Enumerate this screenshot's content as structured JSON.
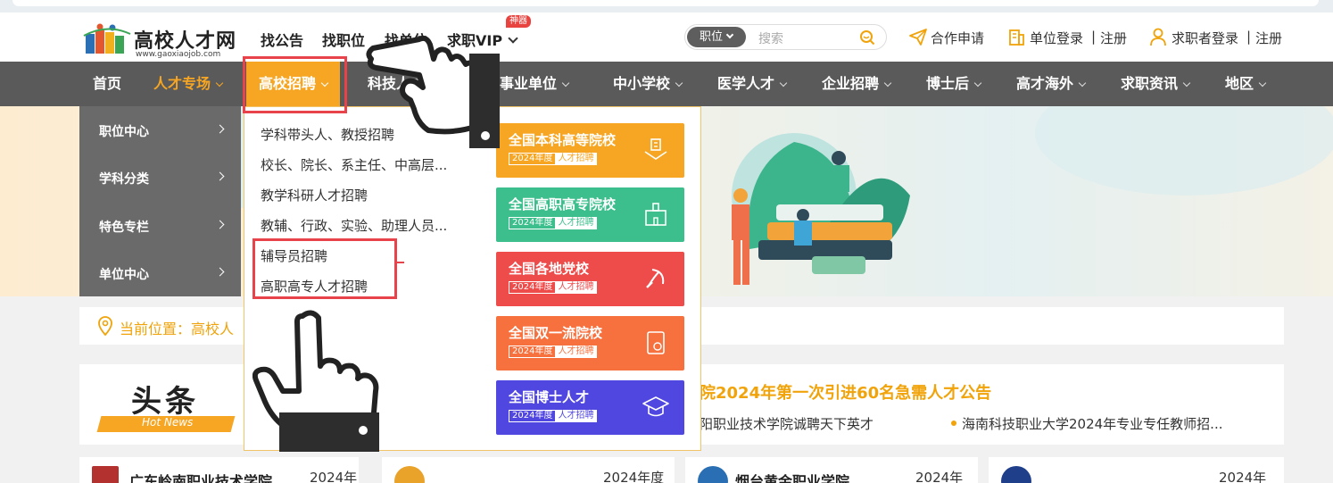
{
  "header": {
    "logo_title": "高校人才网",
    "logo_url": "www.gaoxiaojob.com",
    "top_links": [
      "找公告",
      "找职位",
      "找单位",
      "求职VIP"
    ],
    "vip_badge": "神器",
    "search": {
      "category": "职位",
      "placeholder": "搜索"
    },
    "cooperate": "合作申请",
    "employer_login": "单位登录",
    "employer_register": "注册",
    "seeker_login": "求职者登录",
    "seeker_register": "注册",
    "separator": "|"
  },
  "nav": {
    "items": [
      "首页",
      "人才专场",
      "高校招聘",
      "科技人才",
      "事业单位",
      "中小学校",
      "医学人才",
      "企业招聘",
      "博士后",
      "高才海外",
      "求职资讯",
      "地区"
    ],
    "accent_color": "#f6a623"
  },
  "side_menu": {
    "items": [
      "职位中心",
      "学科分类",
      "特色专栏",
      "单位中心"
    ]
  },
  "dropdown": {
    "links": [
      "学科带头人、教授招聘",
      "校长、院长、系主任、中高层...",
      "教学科研人才招聘",
      "教辅、行政、实验、助理人员...",
      "辅导员招聘",
      "高职高专人才招聘"
    ],
    "cards": [
      {
        "title": "全国本科高等院校",
        "year": "2024年度",
        "tag": "人才招聘",
        "color": "#f6a623",
        "icon": "building-icon"
      },
      {
        "title": "全国高职高专院校",
        "year": "2024年度",
        "tag": "人才招聘",
        "color": "#3cbf8c",
        "icon": "school-icon"
      },
      {
        "title": "全国各地党校",
        "year": "2024年度",
        "tag": "人才招聘",
        "color": "#ee4b4b",
        "icon": "party-emblem-icon"
      },
      {
        "title": "全国双一流院校",
        "year": "2024年度",
        "tag": "人才招聘",
        "color": "#f7713e",
        "icon": "book-icon"
      },
      {
        "title": "全国博士人才",
        "year": "2024年度",
        "tag": "人才招聘",
        "color": "#5046e0",
        "icon": "graduation-cap-icon"
      }
    ]
  },
  "breadcrumb": {
    "text": "当前位置：高校人"
  },
  "news": {
    "title": "头条",
    "title_en": "Hot News",
    "headline": "院2024年第一次引进60名急需人才公告",
    "sub_items": [
      "阳职业技术学院诚聘天下英才",
      "海南科技职业大学2024年专业专任教师招..."
    ]
  },
  "bottom_cards": [
    {
      "name": "广东岭南职业技术学院",
      "year": "2024年"
    },
    {
      "name": "",
      "year": "2024年度"
    },
    {
      "name": "烟台黄金职业学院",
      "year": "2024年"
    },
    {
      "name": "",
      "year": "2024年"
    }
  ]
}
